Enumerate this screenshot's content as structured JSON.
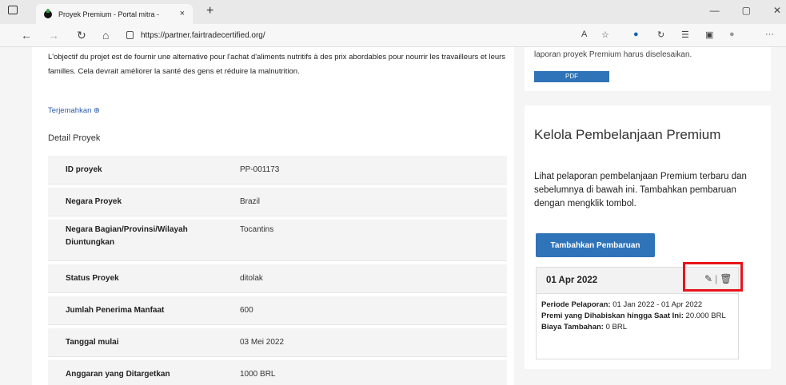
{
  "browser": {
    "tab_title": "Proyek Premium - Portal mitra -",
    "tab_close": "×",
    "new_tab": "+",
    "url": "https://partner.fairtradecertified.org/",
    "window_controls": [
      "—",
      "▢",
      "✕"
    ]
  },
  "intro": {
    "text": "L'objectif du projet est de fournir une alternative pour l'achat d'aliments nutritifs à des prix abordables pour nourrir les travailleurs et leurs familles. Cela devrait améliorer la santé des gens et réduire la malnutrition.",
    "translate_link": "Terjemahkan"
  },
  "details": {
    "title": "Detail Proyek",
    "rows": [
      {
        "label": "ID proyek",
        "value": "PP-001173"
      },
      {
        "label": "Negara Proyek",
        "value": "Brazil"
      },
      {
        "label": "Negara Bagian/Provinsi/Wilayah Diuntungkan",
        "value": "Tocantins"
      },
      {
        "label": "Status Proyek",
        "value": "ditolak"
      },
      {
        "label": "Jumlah Penerima Manfaat",
        "value": "600"
      },
      {
        "label": "Tanggal mulai",
        "value": "03 Mei 2022"
      },
      {
        "label": "Anggaran yang Ditargetkan",
        "value": "1000 BRL"
      }
    ]
  },
  "top_card": {
    "text": "laporan proyek Premium harus diselesaikan.",
    "pdf_label": "PDF"
  },
  "spending": {
    "title": "Kelola Pembelanjaan Premium",
    "description": "Lihat pelaporan pembelanjaan Premium terbaru dan sebelumnya di bawah ini. Tambahkan pembaruan dengan mengklik tombol.",
    "add_button": "Tambahkan Pembaruan",
    "entry": {
      "date": "01 Apr 2022",
      "period_label": "Periode Pelaporan:",
      "period_value": "01 Jan 2022 - 01 Apr 2022",
      "spent_label": "Premi yang Dihabiskan hingga Saat Ini:",
      "spent_value": "20.000 BRL",
      "extra_label": "Biaya Tambahan:",
      "extra_value": "0 BRL"
    }
  },
  "colors": {
    "accent": "#2f73b8",
    "highlight": "#e8141b"
  }
}
